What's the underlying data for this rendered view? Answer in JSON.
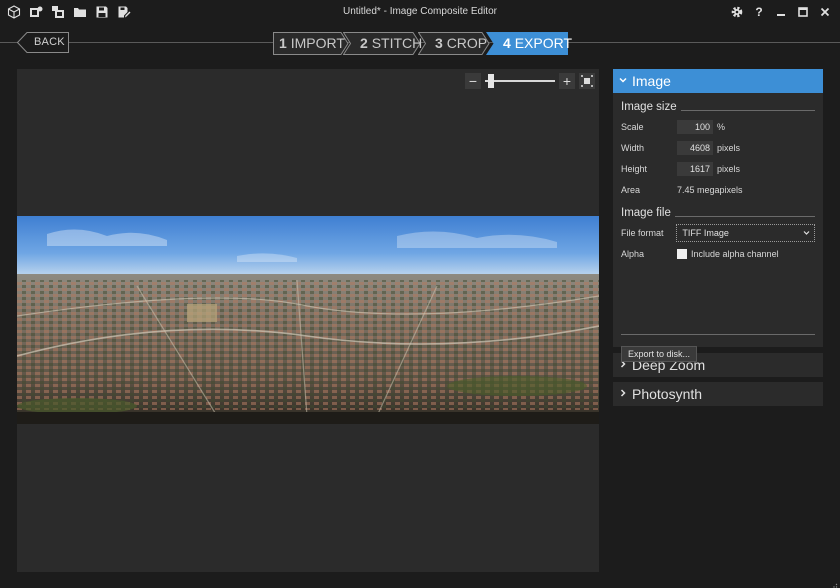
{
  "window": {
    "title": "Untitled* - Image Composite Editor",
    "toolbar_icons": [
      "new-project-icon",
      "new-panorama-icon",
      "new-video-panorama-icon",
      "open-folder-icon",
      "save-icon",
      "save-as-icon"
    ],
    "controls": [
      "gear-icon",
      "help-icon",
      "minimize-icon",
      "maximize-icon",
      "close-icon"
    ],
    "help_glyph": "?"
  },
  "nav": {
    "back_label": "BACK",
    "steps": [
      {
        "num": "1",
        "label": "IMPORT",
        "active": false
      },
      {
        "num": "2",
        "label": "STITCH",
        "active": false
      },
      {
        "num": "3",
        "label": "CROP",
        "active": false
      },
      {
        "num": "4",
        "label": "EXPORT",
        "active": true
      }
    ]
  },
  "zoom": {
    "minus": "−",
    "plus": "+",
    "level_fraction": 0.05
  },
  "panel": {
    "image_section": {
      "title": "Image",
      "image_size_title": "Image size",
      "scale": {
        "label": "Scale",
        "value": "100",
        "unit": "%"
      },
      "width": {
        "label": "Width",
        "value": "4608",
        "unit": "pixels"
      },
      "height": {
        "label": "Height",
        "value": "1617",
        "unit": "pixels"
      },
      "area": {
        "label": "Area",
        "value": "7.45 megapixels"
      },
      "image_file_title": "Image file",
      "file_format": {
        "label": "File format",
        "value": "TIFF Image"
      },
      "alpha": {
        "label": "Alpha",
        "checkbox_label": "Include alpha channel",
        "checked": false
      },
      "export_button": "Export to disk..."
    },
    "deep_zoom": {
      "title": "Deep Zoom"
    },
    "photosynth": {
      "title": "Photosynth"
    }
  },
  "colors": {
    "accent": "#3d8fd6",
    "background": "#1c1c1c",
    "canvas": "#2b2b2b"
  }
}
